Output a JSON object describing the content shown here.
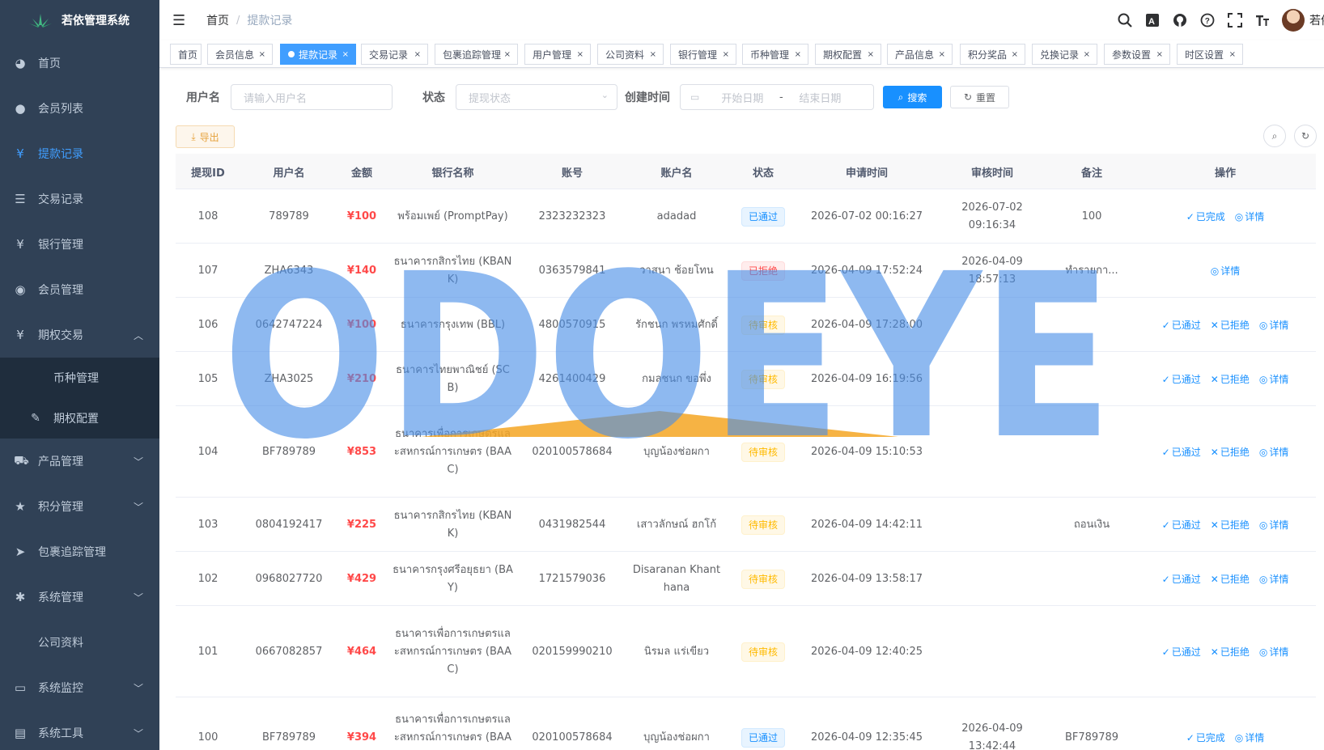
{
  "sidebar": {
    "title": "若依管理系统",
    "items": [
      {
        "label": "首页",
        "icon": "dashboard-icon"
      },
      {
        "label": "会员列表",
        "icon": "user-icon"
      },
      {
        "label": "提款记录",
        "icon": "yen-icon",
        "active": true
      },
      {
        "label": "交易记录",
        "icon": "list-icon"
      },
      {
        "label": "银行管理",
        "icon": "yen-icon"
      },
      {
        "label": "会员管理",
        "icon": "peoples-icon"
      },
      {
        "label": "期权交易",
        "icon": "yen-icon",
        "expanded": true
      },
      {
        "label": "产品管理",
        "icon": "cart-icon"
      },
      {
        "label": "积分管理",
        "icon": "star-icon"
      },
      {
        "label": "包裹追踪管理",
        "icon": "send-icon"
      },
      {
        "label": "系统管理",
        "icon": "gear-icon"
      },
      {
        "label": "公司资料"
      },
      {
        "label": "系统监控",
        "icon": "monitor-icon"
      },
      {
        "label": "系统工具",
        "icon": "tool-icon"
      }
    ],
    "sub_items": [
      {
        "label": "币种管理"
      },
      {
        "label": "期权配置",
        "icon": "edit-icon"
      }
    ]
  },
  "navbar": {
    "breadcrumb": [
      "首页",
      "提款记录"
    ],
    "username": "若依"
  },
  "tags": [
    "首页",
    "会员信息",
    "提款记录",
    "交易记录",
    "包裹追踪管理",
    "用户管理",
    "公司资料",
    "银行管理",
    "币种管理",
    "期权配置",
    "产品信息",
    "积分奖品",
    "兑换记录",
    "参数设置",
    "时区设置"
  ],
  "search": {
    "username_label": "用户名",
    "username_placeholder": "请输入用户名",
    "status_label": "状态",
    "status_placeholder": "提现状态",
    "created_label": "创建时间",
    "start_placeholder": "开始日期",
    "range_sep": "-",
    "end_placeholder": "结束日期",
    "search_btn": "搜索",
    "reset_btn": "重置"
  },
  "toolbar": {
    "export_btn": "导出"
  },
  "table": {
    "columns": [
      "提现ID",
      "用户名",
      "金额",
      "银行名称",
      "账号",
      "账户名",
      "状态",
      "申请时间",
      "审核时间",
      "备注",
      "操作"
    ],
    "rows": [
      {
        "id": "108",
        "user": "789789",
        "amount": "¥100",
        "bank": "พร้อมเพย์ (PromptPay)",
        "account": "2323232323",
        "holder": "adadad",
        "status": "已通过",
        "status_type": "ok",
        "apply": "2026-07-02 00:16:27",
        "audit": "2026-07-02 09:16:34",
        "remark": "100",
        "ops": [
          "已完成",
          "详情"
        ]
      },
      {
        "id": "107",
        "user": "ZHA6343",
        "amount": "¥140",
        "bank": "ธนาคารกสิกรไทย (KBANK)",
        "account": "0363579841",
        "holder": "วาสนา ช้อยโทน",
        "status": "已拒绝",
        "status_type": "rej",
        "apply": "2026-04-09 17:52:24",
        "audit": "2026-04-09 18:57:13",
        "remark": "ทำรายกา...",
        "ops": [
          "详情"
        ]
      },
      {
        "id": "106",
        "user": "0642747224",
        "amount": "¥100",
        "bank": "ธนาคารกรุงเทพ (BBL)",
        "account": "4800570915",
        "holder": "รักชนก พรหมศักดิ์",
        "status": "待审核",
        "status_type": "pend",
        "apply": "2026-04-09 17:28:00",
        "audit": "",
        "remark": "",
        "ops": [
          "已通过",
          "已拒绝",
          "详情"
        ]
      },
      {
        "id": "105",
        "user": "ZHA3025",
        "amount": "¥210",
        "bank": "ธนาคารไทยพาณิชย์ (SCB)",
        "account": "4261400429",
        "holder": "กมลชนก ขอพึ่ง",
        "status": "待审核",
        "status_type": "pend",
        "apply": "2026-04-09 16:19:56",
        "audit": "",
        "remark": "",
        "ops": [
          "已通过",
          "已拒绝",
          "详情"
        ]
      },
      {
        "id": "104",
        "user": "BF789789",
        "amount": "¥853",
        "bank": "ธนาคารเพื่อการเกษตรและสหกรณ์การเกษตร (BAAC)",
        "account": "020100578684",
        "holder": "บุญน้องช่อผกา",
        "status": "待审核",
        "status_type": "pend",
        "apply": "2026-04-09 15:10:53",
        "audit": "",
        "remark": "",
        "ops": [
          "已通过",
          "已拒绝",
          "详情"
        ]
      },
      {
        "id": "103",
        "user": "0804192417",
        "amount": "¥225",
        "bank": "ธนาคารกสิกรไทย (KBANK)",
        "account": "0431982544",
        "holder": "เสาวลักษณ์ ฮกโก้",
        "status": "待审核",
        "status_type": "pend",
        "apply": "2026-04-09 14:42:11",
        "audit": "",
        "remark": "ถอนเงิน",
        "ops": [
          "已通过",
          "已拒绝",
          "详情"
        ]
      },
      {
        "id": "102",
        "user": "0968027720",
        "amount": "¥429",
        "bank": "ธนาคารกรุงศรีอยุธยา (BAY)",
        "account": "1721579036",
        "holder": "Disaranan Khanthana",
        "status": "待审核",
        "status_type": "pend",
        "apply": "2026-04-09 13:58:17",
        "audit": "",
        "remark": "",
        "ops": [
          "已通过",
          "已拒绝",
          "详情"
        ]
      },
      {
        "id": "101",
        "user": "0667082857",
        "amount": "¥464",
        "bank": "ธนาคารเพื่อการเกษตรและสหกรณ์การเกษตร (BAAC)",
        "account": "020159990210",
        "holder": "นิรมล แร่เขียว",
        "status": "待审核",
        "status_type": "pend",
        "apply": "2026-04-09 12:40:25",
        "audit": "",
        "remark": "",
        "ops": [
          "已通过",
          "已拒绝",
          "详情"
        ]
      },
      {
        "id": "100",
        "user": "BF789789",
        "amount": "¥394",
        "bank": "ธนาคารเพื่อการเกษตรและสหกรณ์การเกษตร (BAAC)",
        "account": "020100578684",
        "holder": "บุญน้องช่อผกา",
        "status": "已通过",
        "status_type": "ok",
        "apply": "2026-04-09 12:35:45",
        "audit": "2026-04-09 13:42:44",
        "remark": "BF789789",
        "ops": [
          "已完成",
          "详情"
        ]
      }
    ]
  },
  "watermark": {
    "text": "ODOEYE",
    "color": "#4a8fe8",
    "accent": "#f5a623"
  },
  "colors": {
    "sidebar_bg": "#304156",
    "primary": "#1890ff",
    "danger": "#ff4949",
    "warning": "#ffba00"
  }
}
